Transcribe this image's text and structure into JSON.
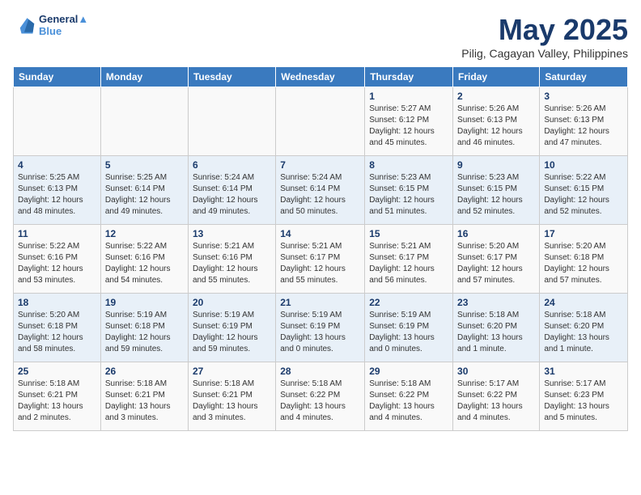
{
  "header": {
    "logo_line1": "General",
    "logo_line2": "Blue",
    "title": "May 2025",
    "subtitle": "Pilig, Cagayan Valley, Philippines"
  },
  "weekdays": [
    "Sunday",
    "Monday",
    "Tuesday",
    "Wednesday",
    "Thursday",
    "Friday",
    "Saturday"
  ],
  "weeks": [
    [
      {
        "day": "",
        "info": ""
      },
      {
        "day": "",
        "info": ""
      },
      {
        "day": "",
        "info": ""
      },
      {
        "day": "",
        "info": ""
      },
      {
        "day": "1",
        "info": "Sunrise: 5:27 AM\nSunset: 6:12 PM\nDaylight: 12 hours\nand 45 minutes."
      },
      {
        "day": "2",
        "info": "Sunrise: 5:26 AM\nSunset: 6:13 PM\nDaylight: 12 hours\nand 46 minutes."
      },
      {
        "day": "3",
        "info": "Sunrise: 5:26 AM\nSunset: 6:13 PM\nDaylight: 12 hours\nand 47 minutes."
      }
    ],
    [
      {
        "day": "4",
        "info": "Sunrise: 5:25 AM\nSunset: 6:13 PM\nDaylight: 12 hours\nand 48 minutes."
      },
      {
        "day": "5",
        "info": "Sunrise: 5:25 AM\nSunset: 6:14 PM\nDaylight: 12 hours\nand 49 minutes."
      },
      {
        "day": "6",
        "info": "Sunrise: 5:24 AM\nSunset: 6:14 PM\nDaylight: 12 hours\nand 49 minutes."
      },
      {
        "day": "7",
        "info": "Sunrise: 5:24 AM\nSunset: 6:14 PM\nDaylight: 12 hours\nand 50 minutes."
      },
      {
        "day": "8",
        "info": "Sunrise: 5:23 AM\nSunset: 6:15 PM\nDaylight: 12 hours\nand 51 minutes."
      },
      {
        "day": "9",
        "info": "Sunrise: 5:23 AM\nSunset: 6:15 PM\nDaylight: 12 hours\nand 52 minutes."
      },
      {
        "day": "10",
        "info": "Sunrise: 5:22 AM\nSunset: 6:15 PM\nDaylight: 12 hours\nand 52 minutes."
      }
    ],
    [
      {
        "day": "11",
        "info": "Sunrise: 5:22 AM\nSunset: 6:16 PM\nDaylight: 12 hours\nand 53 minutes."
      },
      {
        "day": "12",
        "info": "Sunrise: 5:22 AM\nSunset: 6:16 PM\nDaylight: 12 hours\nand 54 minutes."
      },
      {
        "day": "13",
        "info": "Sunrise: 5:21 AM\nSunset: 6:16 PM\nDaylight: 12 hours\nand 55 minutes."
      },
      {
        "day": "14",
        "info": "Sunrise: 5:21 AM\nSunset: 6:17 PM\nDaylight: 12 hours\nand 55 minutes."
      },
      {
        "day": "15",
        "info": "Sunrise: 5:21 AM\nSunset: 6:17 PM\nDaylight: 12 hours\nand 56 minutes."
      },
      {
        "day": "16",
        "info": "Sunrise: 5:20 AM\nSunset: 6:17 PM\nDaylight: 12 hours\nand 57 minutes."
      },
      {
        "day": "17",
        "info": "Sunrise: 5:20 AM\nSunset: 6:18 PM\nDaylight: 12 hours\nand 57 minutes."
      }
    ],
    [
      {
        "day": "18",
        "info": "Sunrise: 5:20 AM\nSunset: 6:18 PM\nDaylight: 12 hours\nand 58 minutes."
      },
      {
        "day": "19",
        "info": "Sunrise: 5:19 AM\nSunset: 6:18 PM\nDaylight: 12 hours\nand 59 minutes."
      },
      {
        "day": "20",
        "info": "Sunrise: 5:19 AM\nSunset: 6:19 PM\nDaylight: 12 hours\nand 59 minutes."
      },
      {
        "day": "21",
        "info": "Sunrise: 5:19 AM\nSunset: 6:19 PM\nDaylight: 13 hours\nand 0 minutes."
      },
      {
        "day": "22",
        "info": "Sunrise: 5:19 AM\nSunset: 6:19 PM\nDaylight: 13 hours\nand 0 minutes."
      },
      {
        "day": "23",
        "info": "Sunrise: 5:18 AM\nSunset: 6:20 PM\nDaylight: 13 hours\nand 1 minute."
      },
      {
        "day": "24",
        "info": "Sunrise: 5:18 AM\nSunset: 6:20 PM\nDaylight: 13 hours\nand 1 minute."
      }
    ],
    [
      {
        "day": "25",
        "info": "Sunrise: 5:18 AM\nSunset: 6:21 PM\nDaylight: 13 hours\nand 2 minutes."
      },
      {
        "day": "26",
        "info": "Sunrise: 5:18 AM\nSunset: 6:21 PM\nDaylight: 13 hours\nand 3 minutes."
      },
      {
        "day": "27",
        "info": "Sunrise: 5:18 AM\nSunset: 6:21 PM\nDaylight: 13 hours\nand 3 minutes."
      },
      {
        "day": "28",
        "info": "Sunrise: 5:18 AM\nSunset: 6:22 PM\nDaylight: 13 hours\nand 4 minutes."
      },
      {
        "day": "29",
        "info": "Sunrise: 5:18 AM\nSunset: 6:22 PM\nDaylight: 13 hours\nand 4 minutes."
      },
      {
        "day": "30",
        "info": "Sunrise: 5:17 AM\nSunset: 6:22 PM\nDaylight: 13 hours\nand 4 minutes."
      },
      {
        "day": "31",
        "info": "Sunrise: 5:17 AM\nSunset: 6:23 PM\nDaylight: 13 hours\nand 5 minutes."
      }
    ]
  ]
}
